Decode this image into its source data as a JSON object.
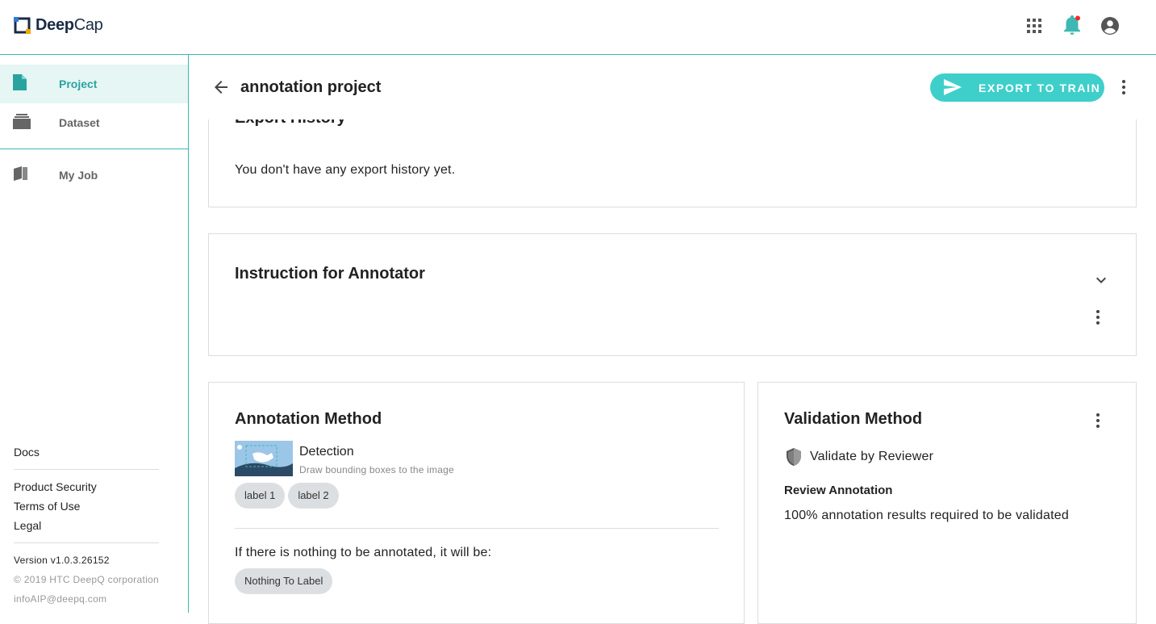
{
  "app": {
    "logo_text_bold": "Deep",
    "logo_text_light": "Cap"
  },
  "topbar": {
    "icons": [
      "apps-grid-icon",
      "bell-icon",
      "account-icon"
    ],
    "notification_dot_color": "#ef2b2b"
  },
  "sidebar": {
    "items": [
      {
        "label": "Project",
        "icon": "file-icon",
        "active": true
      },
      {
        "label": "Dataset",
        "icon": "folder-icon",
        "active": false
      },
      {
        "label": "My Job",
        "icon": "book-icon",
        "active": false
      }
    ],
    "footer": {
      "docs": "Docs",
      "product_security": "Product Security",
      "terms": "Terms of Use",
      "legal": "Legal",
      "version": "Version v1.0.3.26152",
      "copyright": "© 2019 HTC DeepQ corporation",
      "email": "infoAIP@deepq.com"
    }
  },
  "header": {
    "title": "annotation project",
    "export_label": "EXPORT TO TRAIN"
  },
  "export_history": {
    "title": "Export History",
    "empty_text": "You don't have any export history yet."
  },
  "instruction": {
    "title": "Instruction for Annotator"
  },
  "annotation": {
    "title": "Annotation Method",
    "method_name": "Detection",
    "method_desc": "Draw bounding boxes to the image",
    "labels": [
      "label 1",
      "label 2"
    ],
    "nothing_text": "If there is nothing to be annotated, it will be:",
    "nothing_chip": "Nothing To Label"
  },
  "validation": {
    "title": "Validation Method",
    "method": "Validate by Reviewer",
    "review_title": "Review Annotation",
    "review_text": "100% annotation results required to be validated"
  },
  "colors": {
    "accent": "#3fb8b3",
    "button": "#3fcfcb",
    "active_bg": "#e6f6f5",
    "chip": "#dcdfe2"
  }
}
